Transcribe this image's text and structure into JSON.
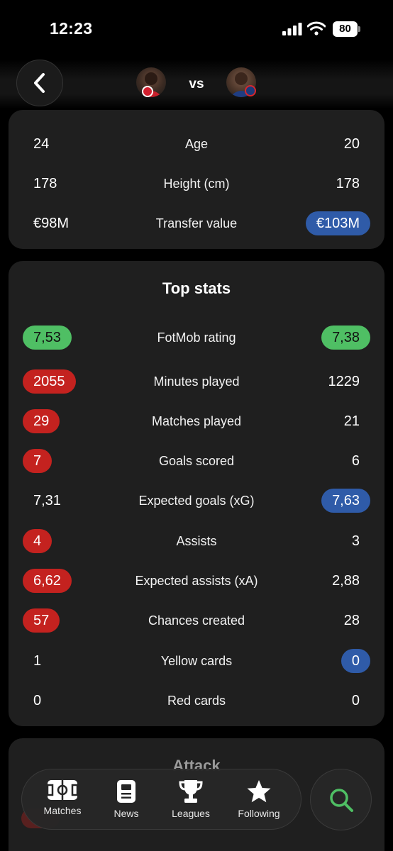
{
  "status_bar": {
    "time": "12:23",
    "battery": "80"
  },
  "header": {
    "vs": "vs",
    "back_icon": "chevron-left-icon"
  },
  "profile": [
    {
      "left": "24",
      "label": "Age",
      "right": "20",
      "left_pill": "",
      "right_pill": ""
    },
    {
      "left": "178",
      "label": "Height (cm)",
      "right": "178",
      "left_pill": "",
      "right_pill": ""
    },
    {
      "left": "€98M",
      "label": "Transfer value",
      "right": "€103M",
      "left_pill": "",
      "right_pill": "blue"
    }
  ],
  "top_stats": {
    "title": "Top stats",
    "rows": [
      {
        "left": "7,53",
        "label": "FotMob rating",
        "right": "7,38",
        "left_pill": "green",
        "right_pill": "green"
      },
      {
        "left": "2055",
        "label": "Minutes played",
        "right": "1229",
        "left_pill": "red",
        "right_pill": ""
      },
      {
        "left": "29",
        "label": "Matches played",
        "right": "21",
        "left_pill": "red",
        "right_pill": ""
      },
      {
        "left": "7",
        "label": "Goals scored",
        "right": "6",
        "left_pill": "red",
        "right_pill": ""
      },
      {
        "left": "7,31",
        "label": "Expected goals (xG)",
        "right": "7,63",
        "left_pill": "",
        "right_pill": "blue"
      },
      {
        "left": "4",
        "label": "Assists",
        "right": "3",
        "left_pill": "red",
        "right_pill": ""
      },
      {
        "left": "6,62",
        "label": "Expected assists (xA)",
        "right": "2,88",
        "left_pill": "red",
        "right_pill": ""
      },
      {
        "left": "57",
        "label": "Chances created",
        "right": "28",
        "left_pill": "red",
        "right_pill": ""
      },
      {
        "left": "1",
        "label": "Yellow cards",
        "right": "0",
        "left_pill": "",
        "right_pill": "blue"
      },
      {
        "left": "0",
        "label": "Red cards",
        "right": "0",
        "left_pill": "",
        "right_pill": ""
      }
    ]
  },
  "attack": {
    "title": "Attack"
  },
  "nav": {
    "items": [
      {
        "label": "Matches",
        "icon": "pitch-icon"
      },
      {
        "label": "News",
        "icon": "news-icon"
      },
      {
        "label": "Leagues",
        "icon": "trophy-icon"
      },
      {
        "label": "Following",
        "icon": "star-icon"
      }
    ],
    "search_icon": "search-icon"
  },
  "colors": {
    "red": "#c4221f",
    "green": "#4fbf64",
    "blue": "#2f5ba8",
    "card": "#1f1f1f"
  }
}
